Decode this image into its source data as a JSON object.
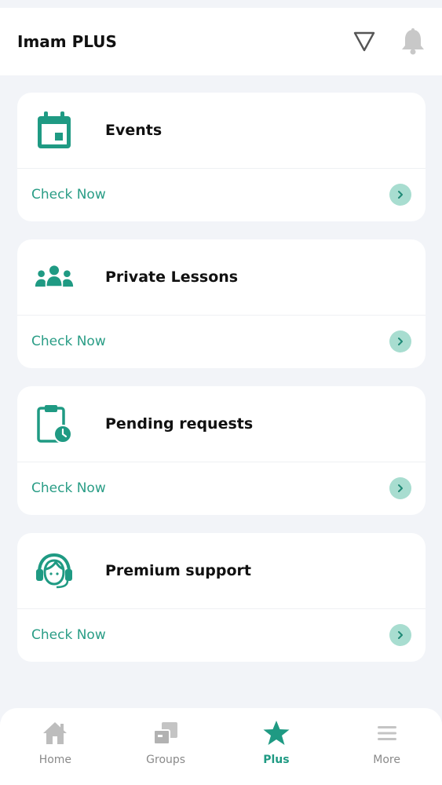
{
  "header": {
    "title": "Imam PLUS",
    "icons": [
      "filter-icon",
      "bell-icon"
    ]
  },
  "cards": [
    {
      "icon": "calendar-icon",
      "title": "Events",
      "action_label": "Check Now"
    },
    {
      "icon": "group-icon",
      "title": "Private Lessons",
      "action_label": "Check Now"
    },
    {
      "icon": "clipboard-clock-icon",
      "title": "Pending requests",
      "action_label": "Check Now"
    },
    {
      "icon": "headset-icon",
      "title": "Premium support",
      "action_label": "Check Now"
    }
  ],
  "bottom_nav": [
    {
      "icon": "home-icon",
      "label": "Home",
      "active": false
    },
    {
      "icon": "groups-icon",
      "label": "Groups",
      "active": false
    },
    {
      "icon": "star-icon",
      "label": "Plus",
      "active": true
    },
    {
      "icon": "menu-icon",
      "label": "More",
      "active": false
    }
  ],
  "colors": {
    "accent": "#1f9a83",
    "link": "#2a9d86",
    "arrow_bg": "#a8ddd0",
    "background": "#f2f4f8",
    "inactive": "#b8b8b8"
  }
}
